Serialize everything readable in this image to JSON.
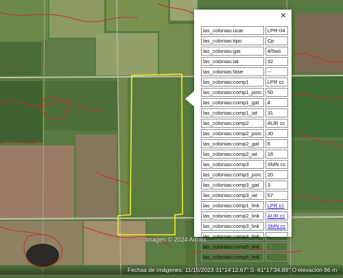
{
  "map": {
    "imagery_credit": "Imagen © 2024 Airbus",
    "status": {
      "imagery_date": "Fechas de imágenes: 11/15/2023",
      "latitude": "31°14'12.67\" S",
      "longitude": "61°17'34.89\" O",
      "elevation": "elevación   66 m"
    },
    "colors": {
      "parcel_outline": "#f2ee2a",
      "soil_contours": "#cc2a2a"
    }
  },
  "popup": {
    "close_icon": "×",
    "rows": [
      {
        "key": "las_colonias:ucar",
        "value": "LPR-04"
      },
      {
        "key": "las_colonias:tipo",
        "value": "Cp"
      },
      {
        "key": "las_colonias:gat",
        "value": "4/5ws"
      },
      {
        "key": "las_colonias:iat",
        "value": "32"
      },
      {
        "key": "las_colonias:fase",
        "value": "--"
      },
      {
        "key": "las_colonias:comp1",
        "value": "LPR cc"
      },
      {
        "key": "las_colonias:comp1_porc",
        "value": "50"
      },
      {
        "key": "las_colonias:comp1_gat",
        "value": "4"
      },
      {
        "key": "las_colonias:comp1_iat",
        "value": "31"
      },
      {
        "key": "las_colonias:comp2",
        "value": "AUR cc"
      },
      {
        "key": "las_colonias:comp2_porc",
        "value": "30"
      },
      {
        "key": "las_colonias:comp2_gat",
        "value": "6"
      },
      {
        "key": "las_colonias:comp2_iat",
        "value": "16"
      },
      {
        "key": "las_colonias:comp3",
        "value": "SMN cc"
      },
      {
        "key": "las_colonias:comp3_porc",
        "value": "20"
      },
      {
        "key": "las_colonias:comp3_gat",
        "value": "3"
      },
      {
        "key": "las_colonias:comp3_iat",
        "value": "57"
      },
      {
        "key": "las_colonias:comp1_link",
        "value": "LPR cc",
        "link": true
      },
      {
        "key": "las_colonias:comp2_link",
        "value": "AUR cc",
        "link": true
      },
      {
        "key": "las_colonias:comp3_link",
        "value": "SMN cc",
        "link": true
      },
      {
        "key": "las_colonias:comp4_link",
        "value": "-"
      },
      {
        "key": "las_colonias:comp5_link",
        "value": "-"
      },
      {
        "key": "las_colonias:comp6_link",
        "value": "-"
      }
    ]
  }
}
